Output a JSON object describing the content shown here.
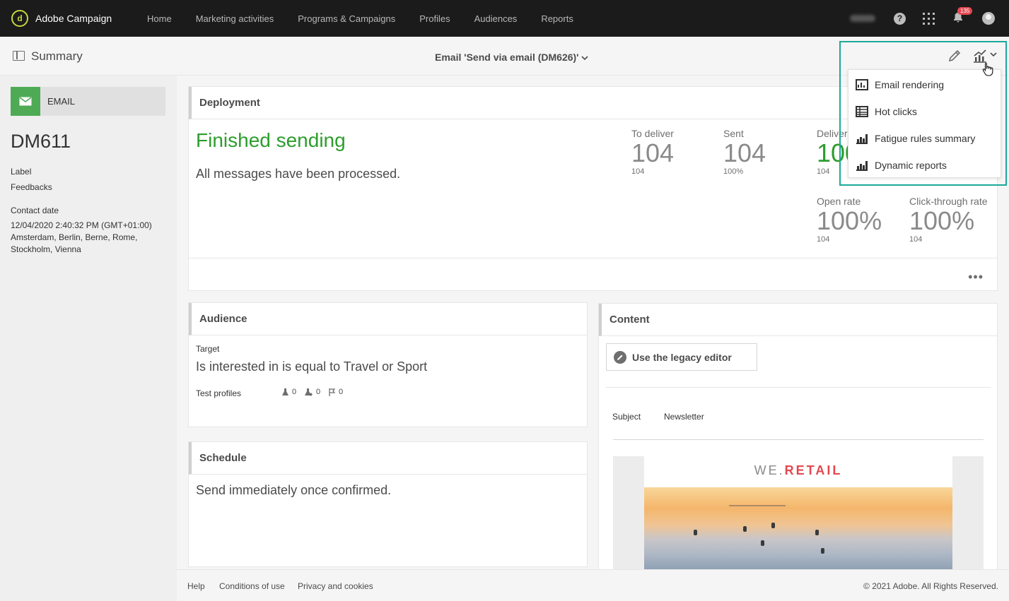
{
  "app": {
    "name": "Adobe Campaign",
    "nav": [
      "Home",
      "Marketing activities",
      "Programs & Campaigns",
      "Profiles",
      "Audiences",
      "Reports"
    ],
    "notification_count": "135"
  },
  "subheader": {
    "summary_label": "Summary",
    "email_title": "Email 'Send via email (DM626)'"
  },
  "left": {
    "type_label": "EMAIL",
    "delivery_id": "DM611",
    "label_title": "Label",
    "label_value": "Feedbacks",
    "contact_date_title": "Contact date",
    "contact_date_value": "12/04/2020 2:40:32 PM (GMT+01:00) Amsterdam, Berlin, Berne, Rome, Stockholm, Vienna"
  },
  "deployment": {
    "title": "Deployment",
    "status": "Finished sending",
    "message": "All messages have been processed.",
    "stats": {
      "to_deliver": {
        "label": "To deliver",
        "value": "104",
        "sub": "104"
      },
      "sent": {
        "label": "Sent",
        "value": "104",
        "sub": "100%"
      },
      "delivered": {
        "label": "Delivered",
        "value": "100%",
        "sub": "104"
      },
      "open_rate": {
        "label": "Open rate",
        "value": "100%",
        "sub": "104"
      },
      "click_rate": {
        "label": "Click-through rate",
        "value": "100%",
        "sub": "104"
      }
    },
    "more_label": "•••"
  },
  "audience": {
    "title": "Audience",
    "target_label": "Target",
    "target_value": "Is interested in is equal to Travel or Sport",
    "test_profiles_label": "Test profiles",
    "counts": [
      "0",
      "0",
      "0"
    ]
  },
  "schedule": {
    "title": "Schedule",
    "text": "Send immediately once confirmed."
  },
  "content": {
    "title": "Content",
    "legacy_button": "Use the legacy editor",
    "subject_label": "Subject",
    "subject_value": "Newsletter",
    "brand_prefix": "WE.",
    "brand_suffix": "RETAIL"
  },
  "reports_menu": {
    "items": [
      "Email rendering",
      "Hot clicks",
      "Fatigue rules summary",
      "Dynamic reports"
    ]
  },
  "footer": {
    "links": [
      "Help",
      "Conditions of use",
      "Privacy and cookies"
    ],
    "copyright": "© 2021 Adobe. All Rights Reserved."
  },
  "colors": {
    "accent_green": "#2d9d2d",
    "email_green": "#4faa56",
    "highlight_teal": "#1ba89a",
    "badge_red": "#e34850",
    "topbar": "#1b1b1b"
  }
}
